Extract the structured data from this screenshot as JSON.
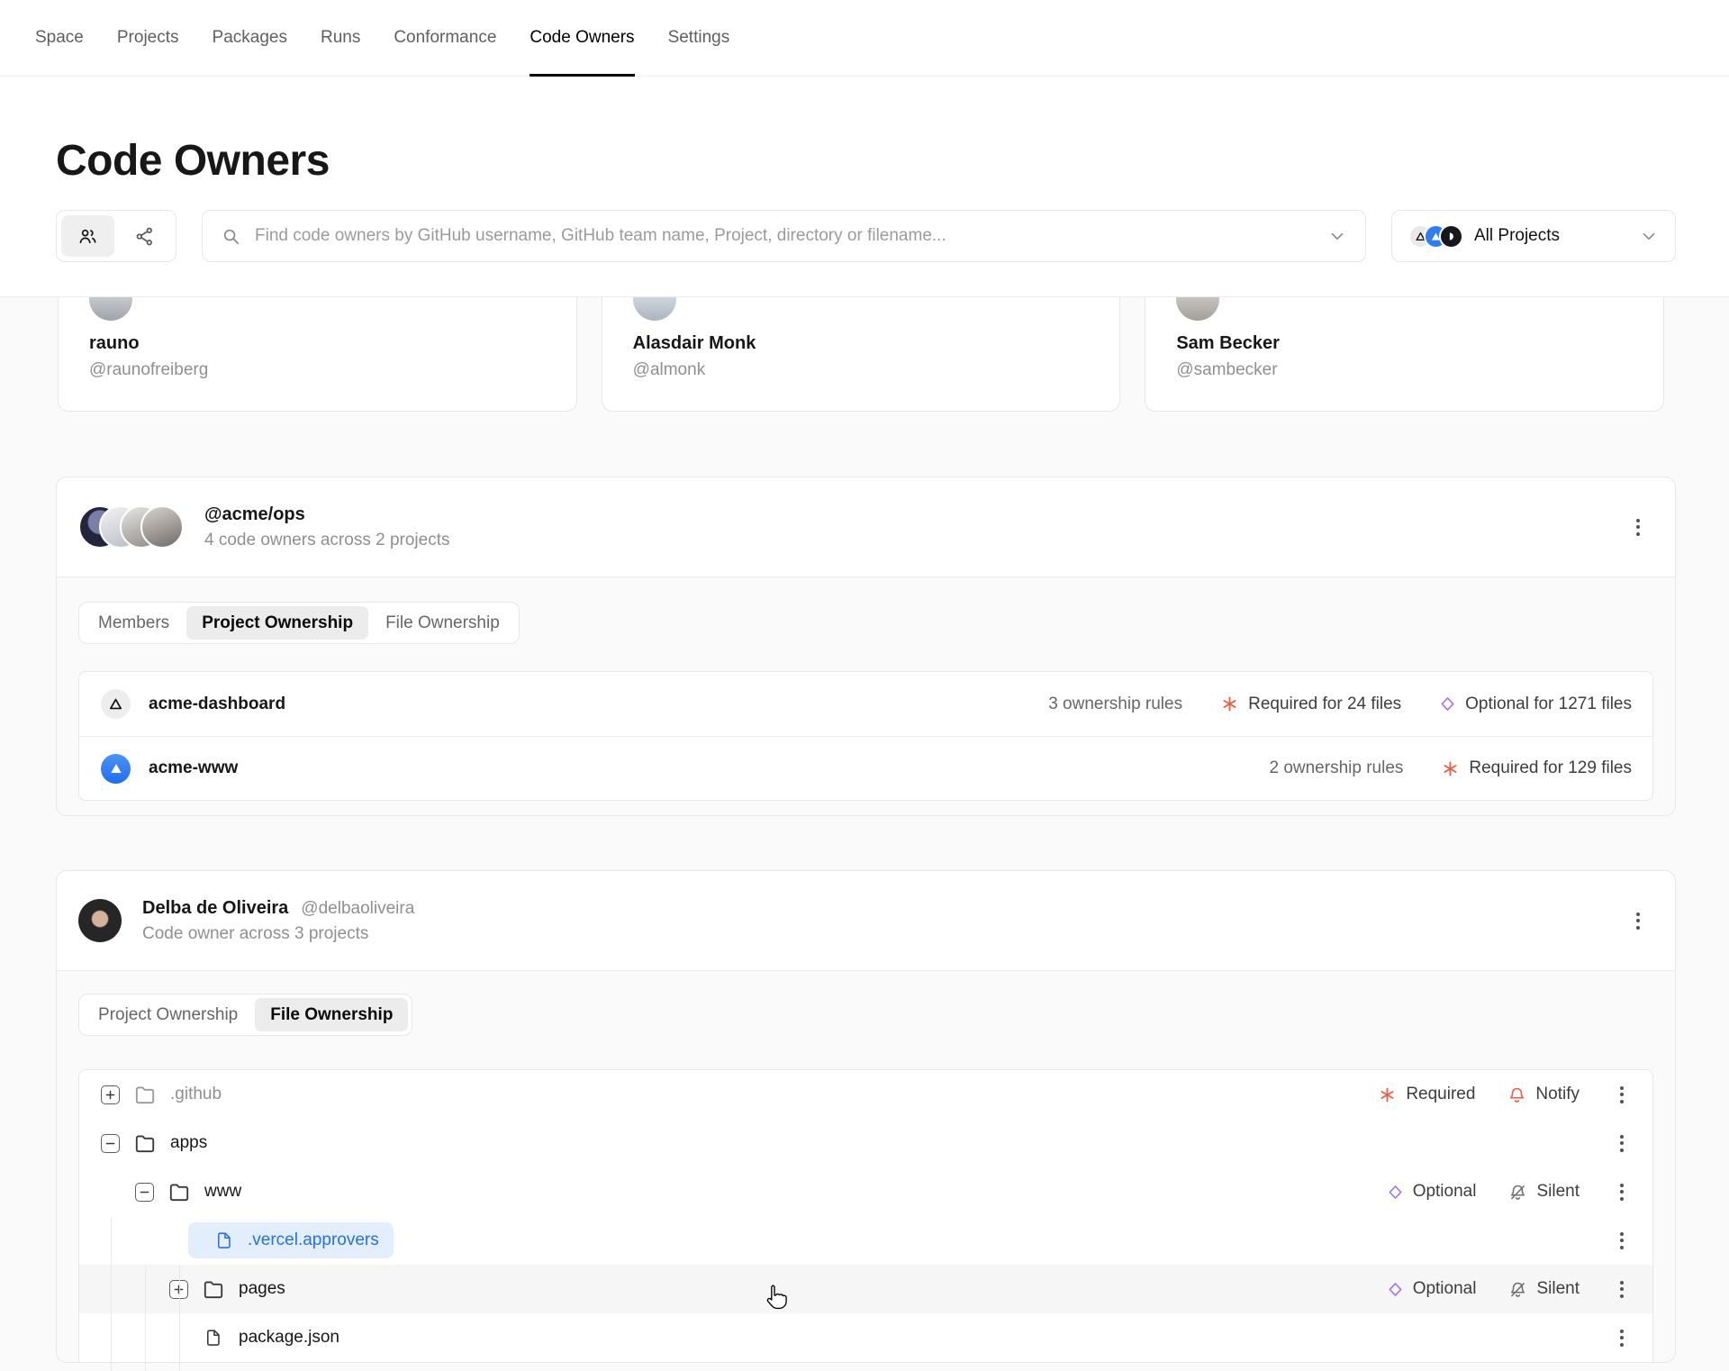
{
  "nav": {
    "items": [
      {
        "label": "Space",
        "slug": "space",
        "active": false
      },
      {
        "label": "Projects",
        "slug": "projects",
        "active": false
      },
      {
        "label": "Packages",
        "slug": "packages",
        "active": false
      },
      {
        "label": "Runs",
        "slug": "runs",
        "active": false
      },
      {
        "label": "Conformance",
        "slug": "conformance",
        "active": false
      },
      {
        "label": "Code Owners",
        "slug": "code-owners",
        "active": true
      },
      {
        "label": "Settings",
        "slug": "settings",
        "active": false
      }
    ]
  },
  "page": {
    "title": "Code Owners"
  },
  "toolbar": {
    "view_toggle_icons": [
      "people-icon",
      "share-graph-icon"
    ],
    "active_toggle": "people-icon",
    "search_placeholder": "Find code owners by GitHub username, GitHub team name, Project, directory or filename...",
    "search_value": "",
    "project_filter": {
      "label": "All Projects",
      "avatar_logos": [
        "triangle-outline-logo",
        "triangle-solid-logo",
        "dark-crescent-logo"
      ]
    }
  },
  "owner_cards": [
    {
      "name": "rauno",
      "username": "@raunofreiberg",
      "avatar_class": "av-rauno"
    },
    {
      "name": "Alasdair Monk",
      "username": "@almonk",
      "avatar_class": "av-almonk"
    },
    {
      "name": "Sam Becker",
      "username": "@sambecker",
      "avatar_class": "av-sam"
    }
  ],
  "team_card": {
    "title": "@acme/ops",
    "subtitle": "4 code owners across 2 projects",
    "member_avatar_count": 4,
    "tabs": [
      {
        "label": "Members",
        "active": false
      },
      {
        "label": "Project Ownership",
        "active": true
      },
      {
        "label": "File Ownership",
        "active": false
      }
    ],
    "projects": [
      {
        "name": "acme-dashboard",
        "logo": "logo-gray",
        "rules": "3 ownership rules",
        "required": "Required for 24 files",
        "optional": "Optional for 1271 files"
      },
      {
        "name": "acme-www",
        "logo": "logo-blue",
        "rules": "2 ownership rules",
        "required": "Required for 129 files",
        "optional": null
      }
    ]
  },
  "person_card": {
    "name": "Delba de Oliveira",
    "username": "@delbaoliveira",
    "subtitle": "Code owner across 3 projects",
    "tabs": [
      {
        "label": "Project Ownership",
        "active": false
      },
      {
        "label": "File Ownership",
        "active": true
      }
    ],
    "tree": [
      {
        "name": ".github",
        "type": "folder",
        "level": 0,
        "expander": "plus",
        "muted": true,
        "rule": "Required",
        "notify": "Notify"
      },
      {
        "name": "apps",
        "type": "folder",
        "level": 0,
        "expander": "minus"
      },
      {
        "name": "www",
        "type": "folder",
        "level": 1,
        "expander": "minus",
        "rule": "Optional",
        "notify": "Silent"
      },
      {
        "name": ".vercel.approvers",
        "type": "file",
        "level": 2,
        "selected": true
      },
      {
        "name": "pages",
        "type": "folder",
        "level": 2,
        "expander": "plus",
        "hover": true,
        "rule": "Optional",
        "notify": "Silent"
      },
      {
        "name": "package.json",
        "type": "file",
        "level": 2
      }
    ]
  },
  "colors": {
    "required_accent": "#ef5b41",
    "optional_accent": "#a06bf7",
    "selected_file_text": "#2570eb",
    "selected_file_bg": "#e3eefc",
    "active_tab_bg": "#ececec",
    "panel_border": "#e7e7e7",
    "page_bg": "#fafafa"
  },
  "icons": [
    "people-icon",
    "share-graph-icon",
    "search-icon",
    "chevron-down-icon",
    "folder-icon",
    "file-icon",
    "plus-box-icon",
    "minus-box-icon",
    "asterisk-icon",
    "diamond-icon",
    "bell-icon",
    "bell-slash-icon",
    "kebab-menu-icon",
    "triangle-logo-icon",
    "hand-cursor"
  ]
}
